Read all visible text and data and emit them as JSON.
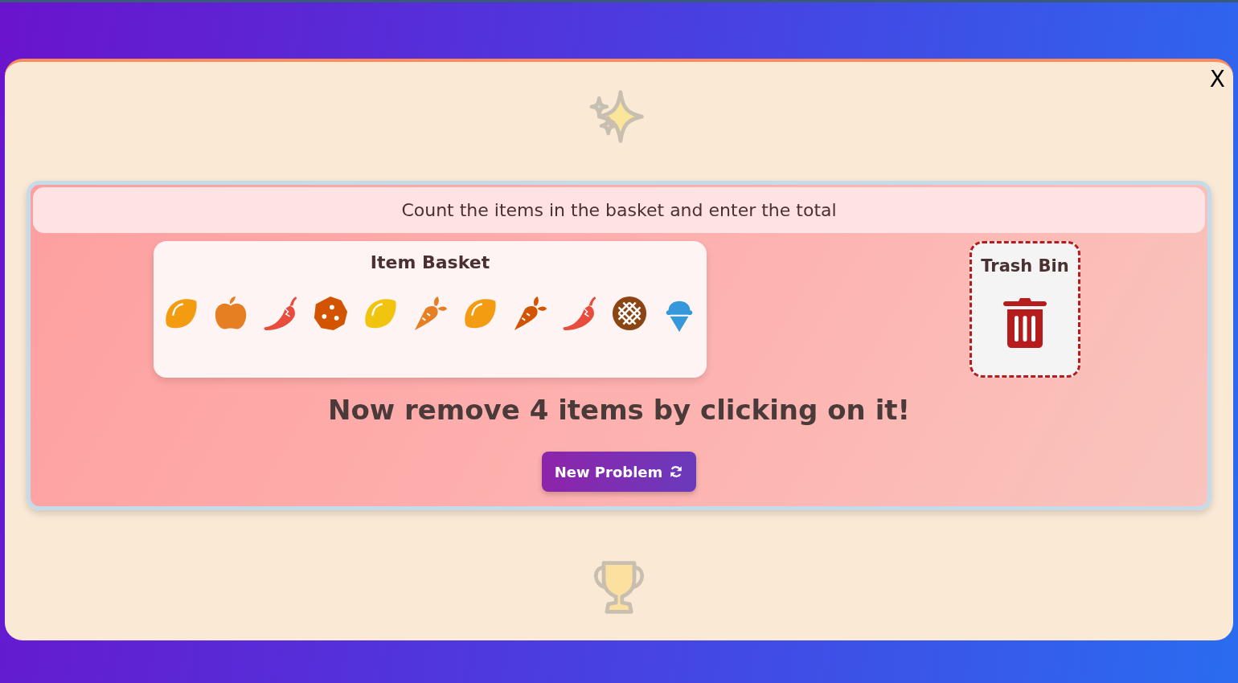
{
  "modal": {
    "close": "X"
  },
  "instruction": "Count the items in the basket and enter the total",
  "basket": {
    "title": "Item Basket",
    "items": [
      {
        "kind": "lemon",
        "color": "#f39c12"
      },
      {
        "kind": "apple",
        "color": "#e67e22"
      },
      {
        "kind": "pepper",
        "color": "#e74c3c"
      },
      {
        "kind": "cookie",
        "color": "#d35400"
      },
      {
        "kind": "lemon",
        "color": "#f1c40f"
      },
      {
        "kind": "carrot",
        "color": "#e67e22"
      },
      {
        "kind": "lemon",
        "color": "#f39c12"
      },
      {
        "kind": "carrot",
        "color": "#d35400"
      },
      {
        "kind": "pepper",
        "color": "#e74c3c"
      },
      {
        "kind": "pie",
        "color": "#8b4513"
      },
      {
        "kind": "icecream",
        "color": "#3498db"
      }
    ]
  },
  "trash": {
    "title": "Trash Bin"
  },
  "prompt": "Now remove 4 items by clicking on it!",
  "button": {
    "label": "New Problem"
  }
}
